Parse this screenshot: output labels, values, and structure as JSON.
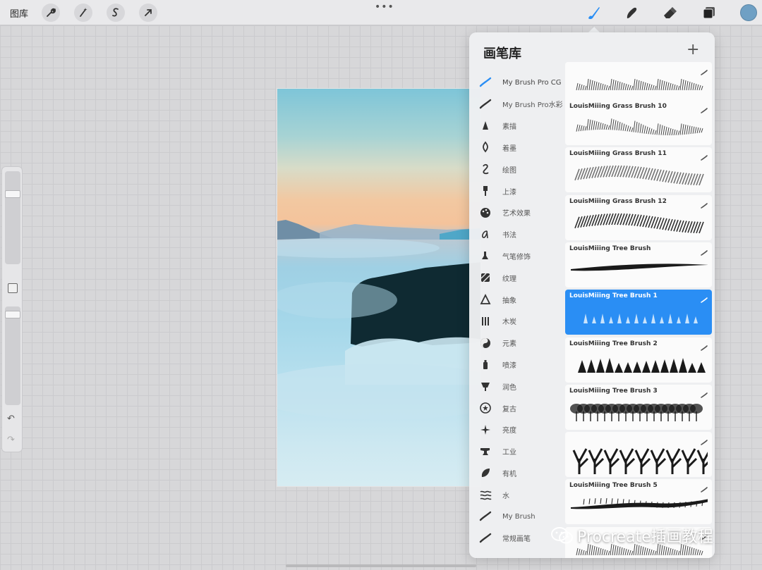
{
  "topbar": {
    "gallery_label": "图库",
    "more_label": "•••",
    "left_tools": [
      "wrench-icon",
      "magic-wand-icon",
      "selection-icon",
      "transform-arrow-icon"
    ],
    "right_tools": [
      "brush-icon",
      "smudge-icon",
      "eraser-icon",
      "layers-icon"
    ],
    "current_color": "#6fa0c4"
  },
  "sidebar": {
    "undo_label": "↶",
    "redo_label": "↷",
    "brush_size_level": 0.78,
    "opacity_level": 0.95
  },
  "brush_library": {
    "title": "画笔库",
    "add_label": "+",
    "accent_color": "#2a8ef4",
    "categories": [
      {
        "label": "My Brush Pro CG",
        "icon": "brush-stroke-icon"
      },
      {
        "label": "My Brush Pro水彩",
        "icon": "brush-stroke-icon"
      },
      {
        "label": "素描",
        "icon": "pencil-tip-icon"
      },
      {
        "label": "着墨",
        "icon": "ink-pen-icon"
      },
      {
        "label": "绘图",
        "icon": "curl-icon"
      },
      {
        "label": "上漆",
        "icon": "paint-brush-icon"
      },
      {
        "label": "艺术效果",
        "icon": "palette-icon"
      },
      {
        "label": "书法",
        "icon": "calligraphy-icon"
      },
      {
        "label": "气笔修饰",
        "icon": "airbrush-icon"
      },
      {
        "label": "纹理",
        "icon": "texture-icon"
      },
      {
        "label": "抽象",
        "icon": "triangle-icon"
      },
      {
        "label": "木炭",
        "icon": "charcoal-icon"
      },
      {
        "label": "元素",
        "icon": "yin-yang-icon"
      },
      {
        "label": "喷漆",
        "icon": "spray-can-icon"
      },
      {
        "label": "润色",
        "icon": "touchup-icon"
      },
      {
        "label": "复古",
        "icon": "star-badge-icon"
      },
      {
        "label": "亮度",
        "icon": "sparkle-icon"
      },
      {
        "label": "工业",
        "icon": "anvil-icon"
      },
      {
        "label": "有机",
        "icon": "leaf-icon"
      },
      {
        "label": "水",
        "icon": "waves-icon"
      },
      {
        "label": "My Brush",
        "icon": "brush-stroke-icon"
      },
      {
        "label": "常规画笔",
        "icon": "brush-stroke-icon"
      }
    ],
    "brushes": [
      {
        "name": "",
        "stroke": "grass-top",
        "selected": false
      },
      {
        "name": "LouisMiiing Grass Brush 10",
        "stroke": "grass-dense",
        "selected": false
      },
      {
        "name": "LouisMiiing Grass Brush 11",
        "stroke": "grass-braid",
        "selected": false
      },
      {
        "name": "LouisMiiing Grass Brush 12",
        "stroke": "grass-braid-dark",
        "selected": false
      },
      {
        "name": "LouisMiiing Tree Brush",
        "stroke": "taper-line",
        "selected": false
      },
      {
        "name": "LouisMiiing Tree Brush 1",
        "stroke": "cones",
        "selected": true
      },
      {
        "name": "LouisMiiing Tree Brush 2",
        "stroke": "pines",
        "selected": false
      },
      {
        "name": "LouisMiiing Tree Brush 3",
        "stroke": "tree-canopy",
        "selected": false
      },
      {
        "name": "",
        "stroke": "bare-trees",
        "selected": false
      },
      {
        "name": "LouisMiiing Tree Brush 5",
        "stroke": "wavy-line",
        "selected": false
      },
      {
        "name": "",
        "stroke": "grass-top",
        "selected": false
      }
    ]
  },
  "watermark": {
    "text": "Procreate插画教程"
  }
}
